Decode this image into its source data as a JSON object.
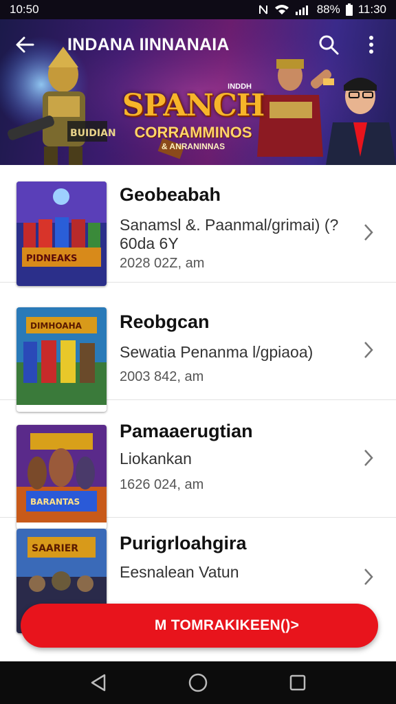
{
  "status_bar": {
    "time_left": "10:50",
    "battery": "88%",
    "time_right": "11:30",
    "icons": [
      "nfc-icon",
      "wifi-icon",
      "signal-icon",
      "battery-icon"
    ]
  },
  "header": {
    "title": "INDANA IINNANAIA",
    "banner_main": "SPANCH",
    "banner_small": "INDDH",
    "banner_sub": "CORRAMMINOS",
    "banner_sub2": "& ANRANINNAS",
    "icons": [
      "arrow-left-icon",
      "search-icon",
      "more-vert-icon"
    ]
  },
  "items": [
    {
      "title": "Geobeabah",
      "subtitle": "Sanamsl &. Paanmal/grimai) (?60da 6Y",
      "time": "2028 02Z, am",
      "thumb_caption": "PIDNEAKS"
    },
    {
      "title": "Reobgcan",
      "subtitle": "Sewatia Penanma l/gpiaoa)",
      "time": "2003 842, am",
      "thumb_caption": "DIMHOAHA"
    },
    {
      "title": "Pamaaerugtian",
      "subtitle": "Liokankan",
      "time": "1626 024, am",
      "thumb_caption": "BARANTAS"
    },
    {
      "title": "Purigrloahgira",
      "subtitle": "Eesnalean Vatun",
      "time": "",
      "thumb_caption": "SAARIER"
    }
  ],
  "cta": {
    "label": "M TOMRAKIKEEN()>"
  },
  "nav": {
    "icons": [
      "back-triangle-icon",
      "home-circle-icon",
      "recents-square-icon"
    ]
  },
  "colors": {
    "accent": "#e8141c",
    "banner_gold": "#f7b52a",
    "status_bg": "#0e0b16"
  }
}
